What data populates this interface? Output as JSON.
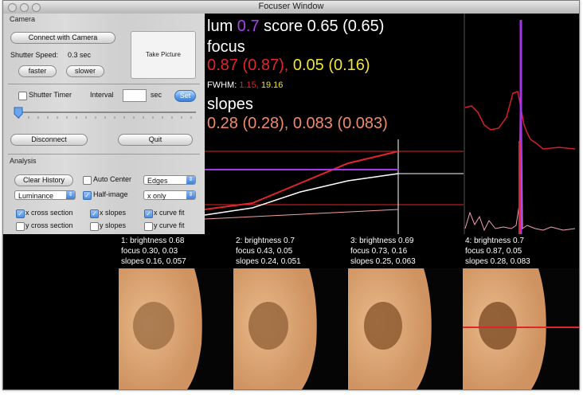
{
  "window": {
    "title": "Focuser Window"
  },
  "camera": {
    "section_label": "Camera",
    "connect_label": "Connect with Camera",
    "take_picture_label": "Take Picture",
    "shutter_label": "Shutter Speed:",
    "shutter_value": "0.3 sec",
    "faster_label": "faster",
    "slower_label": "slower",
    "shutter_timer_label": "Shutter Timer",
    "interval_label": "Interval",
    "interval_value": "",
    "sec_label": "sec",
    "set_label": "Set",
    "slider_value": 0.0,
    "disconnect_label": "Disconnect",
    "quit_label": "Quit"
  },
  "analysis": {
    "section_label": "Analysis",
    "clear_history_label": "Clear History",
    "auto_center_label": "Auto Center",
    "auto_center_checked": false,
    "edges_selected": "Edges",
    "luminance_selected": "Luminance",
    "half_image_label": "Half-image",
    "half_image_checked": true,
    "x_only_selected": "x only",
    "checks": [
      {
        "label": "x cross section",
        "checked": true
      },
      {
        "label": "x slopes",
        "checked": true
      },
      {
        "label": "x curve fit",
        "checked": true
      },
      {
        "label": "y cross section",
        "checked": false
      },
      {
        "label": "y slopes",
        "checked": false
      },
      {
        "label": "y curve fit",
        "checked": false
      }
    ]
  },
  "readout": {
    "lum_label": "lum",
    "lum_value": "0.7",
    "score_label": "score 0.65 (0.65)",
    "focus_label": "focus",
    "focus_red": "0.87 (0.87),",
    "focus_yellow": "0.05 (0.16)",
    "fwhm_label": "FWHM:",
    "fwhm_red": "1.15,",
    "fwhm_yellow": "19.16",
    "slopes_label": "slopes",
    "slopes_pink": "0.28 (0.28), 0.083 (0.083)",
    "colors": {
      "purple": "#b23cf2",
      "red": "#e0262a",
      "yellow": "#f2e23a",
      "salmon": "#f08a6c",
      "white": "#ffffff"
    }
  },
  "captures": [
    {
      "l1": "1: brightness 0.68",
      "l2": "focus 0.30, 0.03",
      "l3": "slopes 0.16, 0.057"
    },
    {
      "l1": "2: brightness 0.7",
      "l2": "focus 0.43, 0.05",
      "l3": "slopes 0.24, 0.051"
    },
    {
      "l1": "3: brightness 0.69",
      "l2": "focus 0.73, 0.16",
      "l3": "slopes 0.25, 0.063"
    },
    {
      "l1": "4: brightness 0.7",
      "l2": "focus 0.87, 0.05",
      "l3": "slopes 0.28, 0.083"
    }
  ]
}
